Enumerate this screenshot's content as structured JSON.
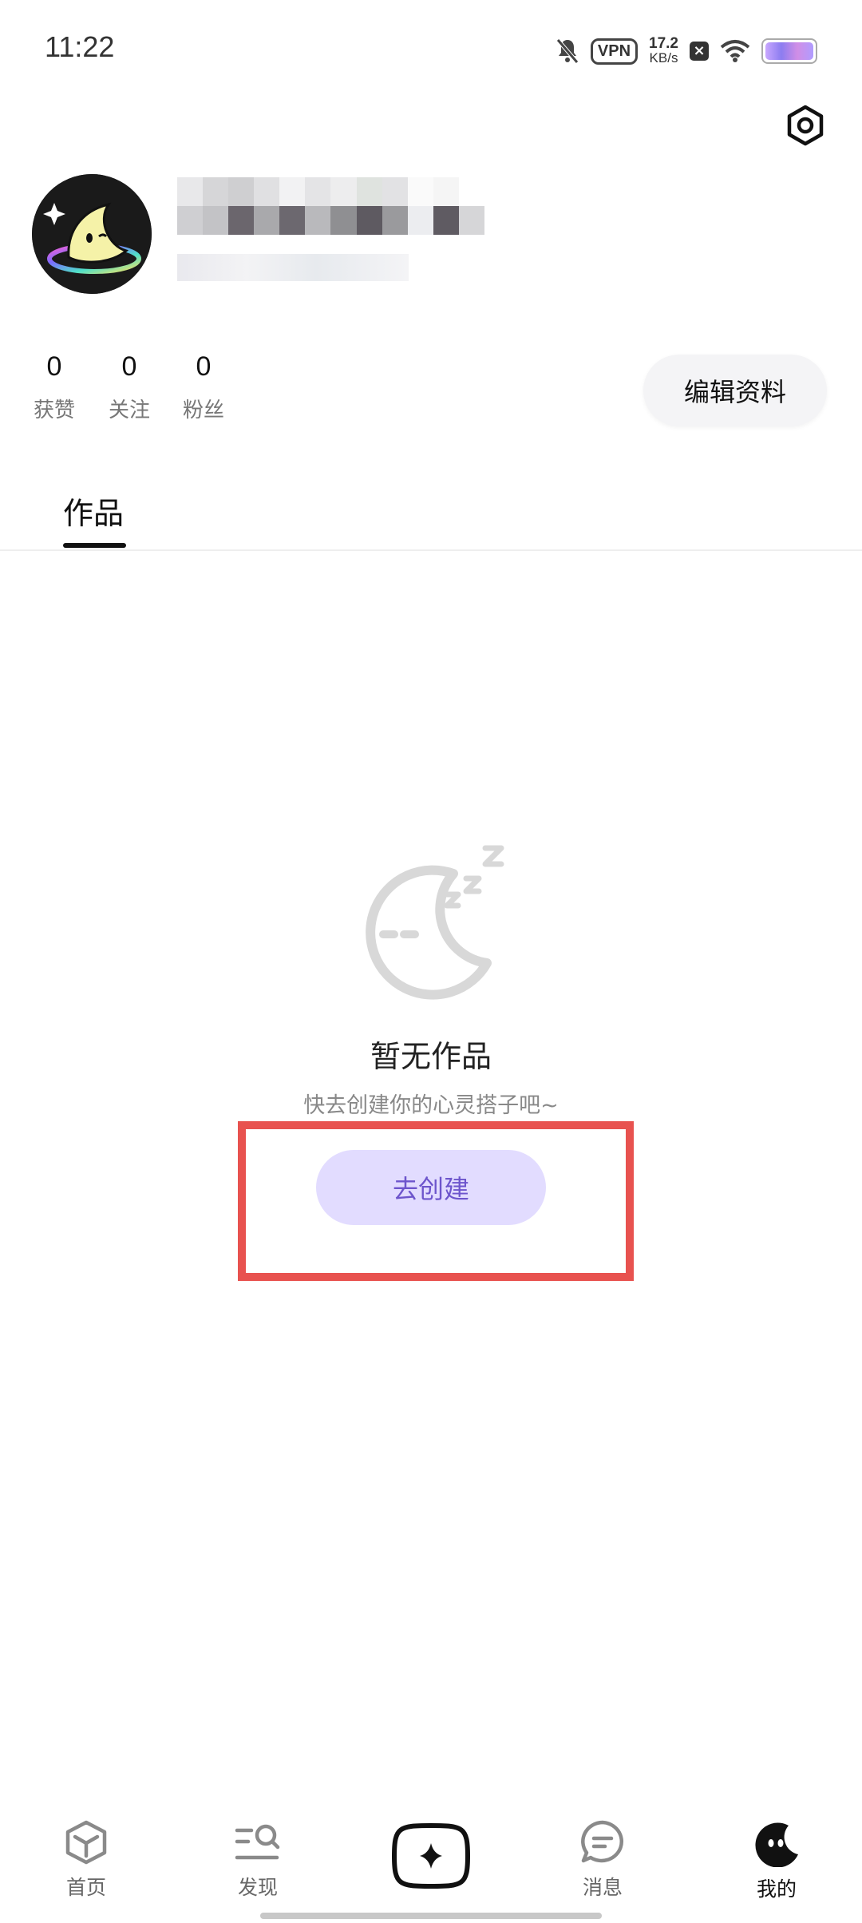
{
  "status_bar": {
    "time": "11:22",
    "vpn": "VPN",
    "net_speed_value": "17.2",
    "net_speed_unit": "KB/s",
    "icons": [
      "bell-muted-icon",
      "vpn-icon",
      "close-icon",
      "wifi-icon",
      "battery-icon"
    ]
  },
  "profile": {
    "stats": [
      {
        "value": "0",
        "label": "获赞"
      },
      {
        "value": "0",
        "label": "关注"
      },
      {
        "value": "0",
        "label": "粉丝"
      }
    ],
    "edit_button": "编辑资料"
  },
  "tabs": [
    {
      "label": "作品",
      "active": true
    }
  ],
  "empty_state": {
    "title": "暂无作品",
    "subtitle": "快去创建你的心灵搭子吧~",
    "action": "去创建"
  },
  "bottom_nav": [
    {
      "label": "首页",
      "icon": "cube-icon"
    },
    {
      "label": "发现",
      "icon": "discover-search-icon"
    },
    {
      "label": "",
      "icon": "sparkle-create-icon"
    },
    {
      "label": "消息",
      "icon": "chat-bubble-icon"
    },
    {
      "label": "我的",
      "icon": "mascot-face-icon",
      "active": true
    }
  ],
  "colors": {
    "accent_purple": "#6d55cc",
    "button_lavender": "#e2dcff",
    "highlight_red": "#e8524f"
  }
}
